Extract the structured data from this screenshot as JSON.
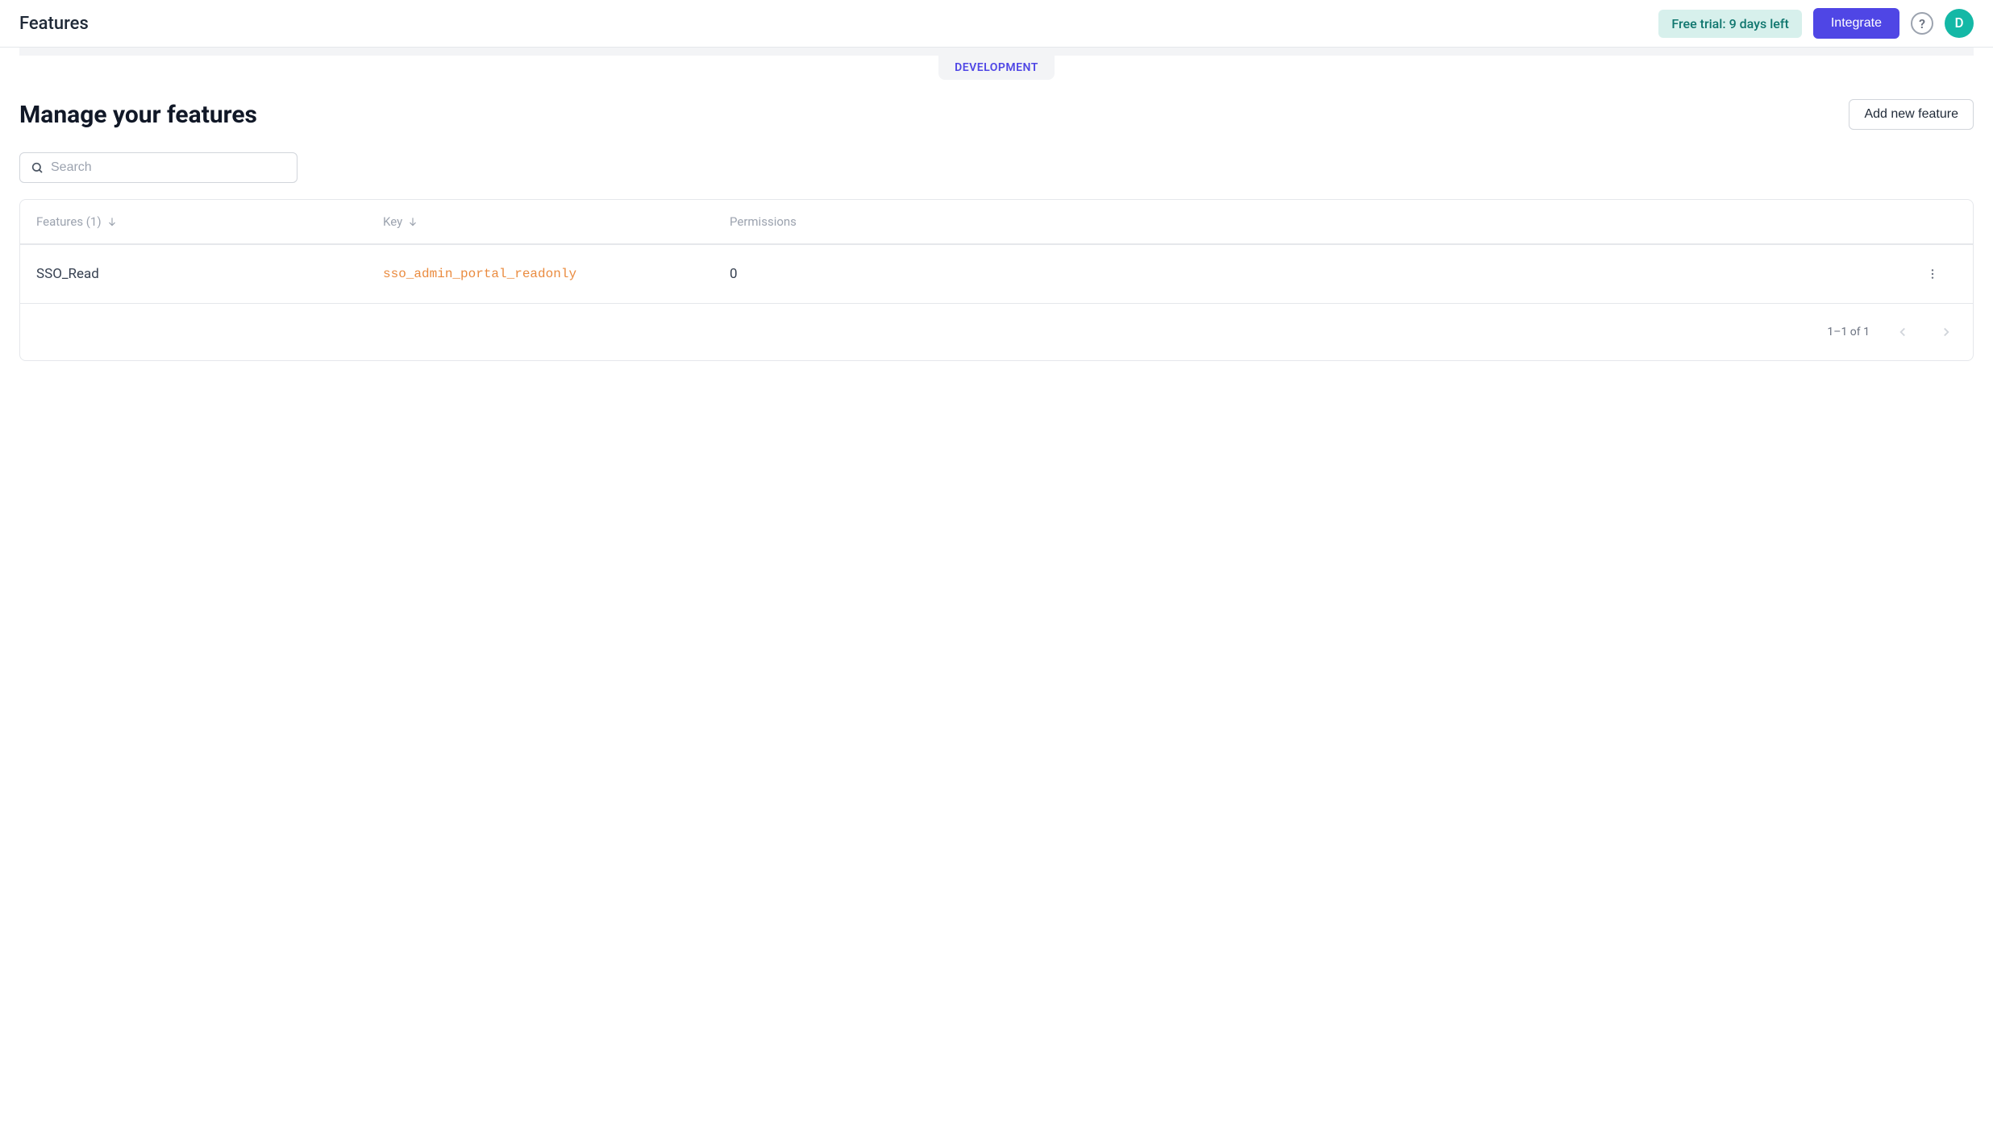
{
  "header": {
    "title": "Features",
    "trial_label": "Free trial: 9 days left",
    "integrate_label": "Integrate",
    "help_tooltip": "?",
    "avatar_initial": "D"
  },
  "env_tab": "DEVELOPMENT",
  "page": {
    "title": "Manage your features",
    "add_button": "Add new feature"
  },
  "search": {
    "placeholder": "Search",
    "value": ""
  },
  "table": {
    "columns": {
      "features_label": "Features (1)",
      "key_label": "Key",
      "permissions_label": "Permissions"
    },
    "rows": [
      {
        "name": "SSO_Read",
        "key": "sso_admin_portal_readonly",
        "permissions": "0"
      }
    ],
    "pagination": "1–1 of 1"
  }
}
